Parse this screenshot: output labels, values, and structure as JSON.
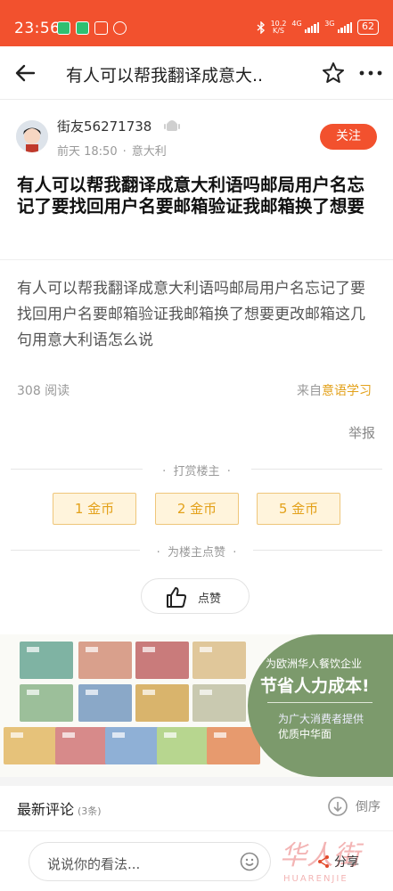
{
  "status_bar": {
    "time": "23:56",
    "speed_top": "10.2",
    "speed_bottom": "K/S",
    "net_1": "4G",
    "net_2": "3G",
    "battery": "62"
  },
  "header": {
    "title": "有人可以帮我翻译成意大.."
  },
  "author": {
    "name": "街友56271738",
    "time": "前天 18:50",
    "location": "意大利",
    "follow_label": "关注"
  },
  "post": {
    "title": "有人可以帮我翻译成意大利语吗邮局用户名忘记了要找回用户名要邮箱验证我邮箱换了想要",
    "body": "有人可以帮我翻译成意大利语吗邮局用户名忘记了要找回用户名要邮箱验证我邮箱换了想要更改邮箱这几句用意大利语怎么说",
    "reads": "308 阅读",
    "source_prefix": "来自",
    "source_name": "意语学习",
    "report_label": "举报"
  },
  "reward": {
    "label": "打赏楼主",
    "options": [
      "1 金币",
      "2 金币",
      "5 金币"
    ]
  },
  "like": {
    "label": "为楼主点赞",
    "button_label": "点赞"
  },
  "ad": {
    "line1": "为欧洲华人餐饮企业",
    "line2": "节省人力成本!",
    "line3": "为广大消费者提供",
    "line4": "优质中华面"
  },
  "comments": {
    "title": "最新评论",
    "count": "(3条)",
    "sort_label": "倒序"
  },
  "bottom": {
    "input_placeholder": "说说你的看法...",
    "share_label": "分享",
    "watermark_cn": "华人街",
    "watermark_en": "HUARENJIE"
  },
  "colors": {
    "accent": "#f2512e",
    "coin": "#e3a11a",
    "ad_green": "#7c9a6c"
  }
}
